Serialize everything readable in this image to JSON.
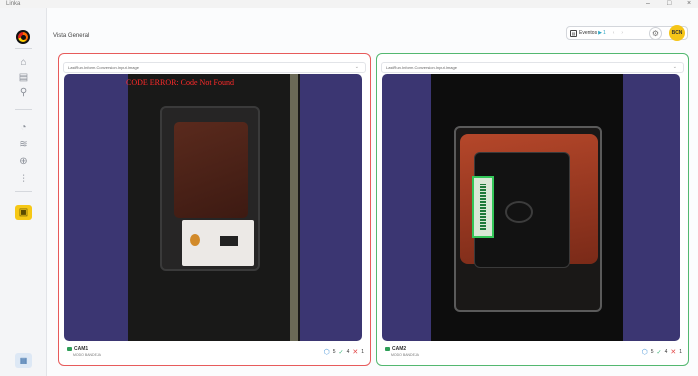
{
  "window": {
    "app_name": "Linka",
    "controls": [
      "–",
      "□",
      "×"
    ]
  },
  "sidebar": {
    "icons": [
      "home-icon",
      "document-icon",
      "pin-icon",
      "gauge-icon",
      "layers-icon",
      "globe-icon",
      "chart-icon",
      "camera-settings-icon",
      "grid-icon"
    ],
    "active": "camera-settings-icon"
  },
  "header": {
    "title": "Vista General",
    "events_label": "Eventos",
    "events_count": "1",
    "avatar_initials": "BCN"
  },
  "cards": [
    {
      "status": "error",
      "status_color": "#e75b5b",
      "source": "LastRun.Inform.Conversion.Input.Image",
      "error_text": "CODE ERROR: Code Not Found",
      "camera_name": "CAM1",
      "mode": "MODO BANDEJA",
      "stat_total": "5",
      "stat_ok": "4",
      "stat_fail": "1"
    },
    {
      "status": "ok",
      "status_color": "#53b870",
      "source": "LastRun.Inform.Conversion.Input.Image",
      "error_text": "",
      "camera_name": "CAM2",
      "mode": "MODO BANDEJA",
      "stat_total": "5",
      "stat_ok": "4",
      "stat_fail": "1"
    }
  ]
}
